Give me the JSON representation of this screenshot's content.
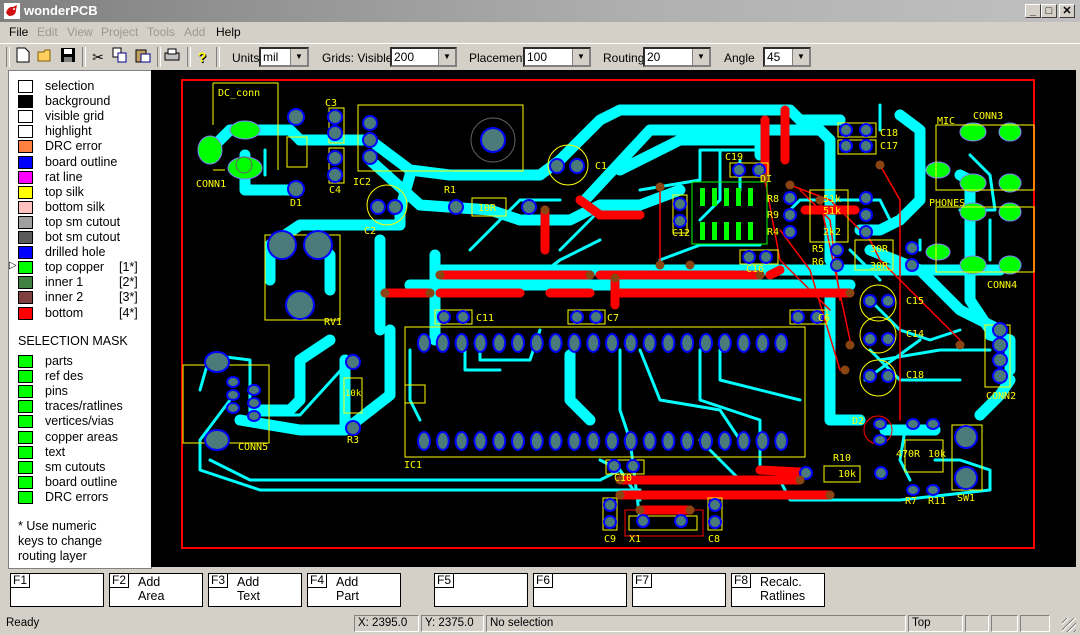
{
  "window": {
    "title": "wonderPCB",
    "controls": {
      "minimize": "_",
      "maximize": "□",
      "close": "✕"
    }
  },
  "menu": [
    {
      "label": "File",
      "enabled": true
    },
    {
      "label": "Edit",
      "enabled": false
    },
    {
      "label": "View",
      "enabled": false
    },
    {
      "label": "Project",
      "enabled": false
    },
    {
      "label": "Tools",
      "enabled": false
    },
    {
      "label": "Add",
      "enabled": false
    },
    {
      "label": "Help",
      "enabled": true
    }
  ],
  "toolbar": {
    "icons": [
      "new-file-icon",
      "open-folder-icon",
      "save-icon",
      "cut-icon",
      "copy-icon",
      "paste-icon",
      "print-icon",
      "help-icon"
    ],
    "units": {
      "label": "Units",
      "value": "mil"
    },
    "grids": {
      "label": "Grids: Visible",
      "value": "200"
    },
    "placement": {
      "label": "Placement",
      "value": "100"
    },
    "routing": {
      "label": "Routing",
      "value": "20"
    },
    "angle": {
      "label": "Angle",
      "value": "45"
    }
  },
  "layers": [
    {
      "label": "selection",
      "color": "#ffffff"
    },
    {
      "label": "background",
      "color": "#000000"
    },
    {
      "label": "visible grid",
      "color": "#ffffff"
    },
    {
      "label": "highlight",
      "color": "#ffffff"
    },
    {
      "label": "DRC error",
      "color": "#ff8040"
    },
    {
      "label": "board outline",
      "color": "#0000ff"
    },
    {
      "label": "rat line",
      "color": "#ff00ff"
    },
    {
      "label": "top silk",
      "color": "#ffff00"
    },
    {
      "label": "bottom silk",
      "color": "#ffc0c0"
    },
    {
      "label": "top sm cutout",
      "color": "#a0a0a0"
    },
    {
      "label": "bot sm cutout",
      "color": "#5a5a5a"
    },
    {
      "label": "drilled hole",
      "color": "#0000ff"
    },
    {
      "label": "top copper",
      "num": "[1*]",
      "color": "#00ff00",
      "active": true
    },
    {
      "label": "inner 1",
      "num": "[2*]",
      "color": "#408040"
    },
    {
      "label": "inner 2",
      "num": "[3*]",
      "color": "#804040"
    },
    {
      "label": "bottom",
      "num": "[4*]",
      "color": "#ff0000"
    }
  ],
  "selection_mask": {
    "title": "SELECTION MASK",
    "items": [
      {
        "label": "parts",
        "color": "#00ff00"
      },
      {
        "label": "ref des",
        "color": "#00ff00"
      },
      {
        "label": "pins",
        "color": "#00ff00"
      },
      {
        "label": "traces/ratlines",
        "color": "#00ff00"
      },
      {
        "label": "vertices/vias",
        "color": "#00ff00"
      },
      {
        "label": "copper areas",
        "color": "#00ff00"
      },
      {
        "label": "text",
        "color": "#00ff00"
      },
      {
        "label": "sm cutouts",
        "color": "#00ff00"
      },
      {
        "label": "board outline",
        "color": "#00ff00"
      },
      {
        "label": "DRC errors",
        "color": "#00ff00"
      }
    ],
    "note": [
      "* Use numeric",
      "keys to change",
      "routing layer"
    ]
  },
  "pcb": {
    "colors": {
      "top_copper": "#00ffff",
      "bottom": "#ff0000",
      "silk": "#ffff00",
      "pad": "#4a7a7a",
      "pad_ring": "#0000ff",
      "outline": "#ff0000",
      "area": "#00ff00",
      "via": "#8b4513"
    },
    "refdes": {
      "dc_conn": "DC_conn",
      "conn1": "CONN1",
      "d1": "D1",
      "c3": "C3",
      "c4": "C4",
      "ic2": "IC2",
      "c2": "C2",
      "r1": "R1",
      "r1_val": "10R",
      "c1": "C1",
      "rv1": "RV1",
      "conn5": "CONN5",
      "r3": "R3",
      "r3_val": "10k",
      "ic1": "IC1",
      "c11": "C11",
      "c7": "C7",
      "c6": "C6",
      "c19": "C19",
      "c12": "C12",
      "c16": "C16",
      "u": "DI",
      "r8": "R8",
      "r9": "R9",
      "r4": "R4",
      "r8_val": "51k",
      "r9_val": "51k",
      "r4_val": "2k2",
      "r5": "R5",
      "r6": "R6",
      "r5_val": "30R",
      "r6_val": "30R",
      "c18": "C18",
      "c17": "C17",
      "mic": "MIC",
      "conn3": "CONN3",
      "phones": "PHONES",
      "conn4": "CONN4",
      "c15": "C15",
      "c14": "C14",
      "c13": "C18",
      "conn2": "CONN2",
      "d2": "D2",
      "r10": "R10",
      "r10_val": "10k",
      "r7_val": "470R",
      "r11_val": "10k",
      "r7": "R7",
      "r11": "R11",
      "sw1": "SW1",
      "c10": "C10",
      "c9": "C9",
      "x1": "X1",
      "c8": "C8"
    }
  },
  "fkeys": [
    {
      "key": "F1",
      "text": ""
    },
    {
      "key": "F2",
      "text": "Add\nArea"
    },
    {
      "key": "F3",
      "text": "Add\nText"
    },
    {
      "key": "F4",
      "text": "Add\nPart"
    },
    {
      "key": "F5",
      "text": ""
    },
    {
      "key": "F6",
      "text": ""
    },
    {
      "key": "F7",
      "text": ""
    },
    {
      "key": "F8",
      "text": "Recalc.\nRatlines"
    }
  ],
  "status": {
    "message": "Ready",
    "x": "X:  2395.0",
    "y": "Y:  2375.0",
    "selection": "No selection",
    "layer": "Top"
  }
}
